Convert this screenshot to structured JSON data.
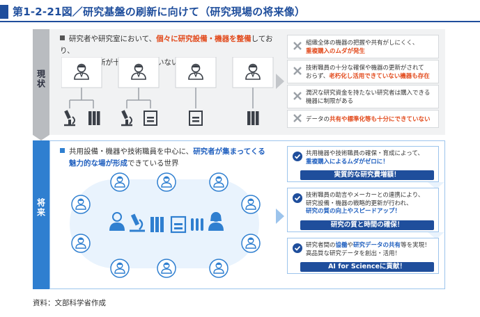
{
  "header": {
    "title": "第1-2-21図／研究基盤の刷新に向けて（研究現場の将来像）"
  },
  "current": {
    "label": "現状",
    "intro_prefix": "研究者や研究室において、",
    "intro_highlight": "個々に研究設備・機器を整備",
    "intro_suffix": "しており、",
    "intro_line2": "管理や更新が十分にできていない世界",
    "problems": [
      {
        "text_a": "組織全体の機器の把握や共有がしにくく、",
        "highlight": "重複購入のムダが発生",
        "text_b": ""
      },
      {
        "text_a": "技術職員の十分な確保や機器の更新がされて",
        "text_mid": "おらず、",
        "highlight": "老朽化し活用できていない機器も存在",
        "text_b": ""
      },
      {
        "text_a": "潤沢な研究資金を持たない研究者は購入できる",
        "text_mid": "機器に制限がある",
        "highlight": "",
        "text_b": ""
      },
      {
        "text_a": "データの",
        "highlight": "共有や標準化等も十分にできていない",
        "text_b": ""
      }
    ]
  },
  "future": {
    "label": "将来",
    "intro_prefix": "共用設備・機器や技術職員を中心に、",
    "intro_highlight1": "研究者が集まってくる",
    "intro_highlight2": "魅力的な場が形成",
    "intro_suffix": "できている世界",
    "benefits": [
      {
        "line1": "共用機器や技術職員の確保・育成によって、",
        "line2_highlight": "重複購入によるムダがゼロに！",
        "bar": "実質的な研究費増額！"
      },
      {
        "line1": "技術職員の助言やメーカーとの連携により、",
        "line2": "研究設備・機器の戦略的更新が行われ、",
        "line3_highlight": "研究の質の向上やスピードアップ！",
        "bar": "研究の質と時間の確保！"
      },
      {
        "line1_prefix": "研究者間の",
        "line1_highlight1": "協働",
        "line1_mid": "や",
        "line1_highlight2": "研究データの共有",
        "line1_suffix": "等を実現！",
        "line2": "高品質な研究データを創出・活用！",
        "bar": "AI for Scienceに貢献！"
      }
    ]
  },
  "source": "資料：文部科学省作成",
  "colors": {
    "navy": "#1f4e9c",
    "blue": "#2f7fd0",
    "red": "#e24a1c",
    "gray_tab": "#b9bcc0"
  }
}
